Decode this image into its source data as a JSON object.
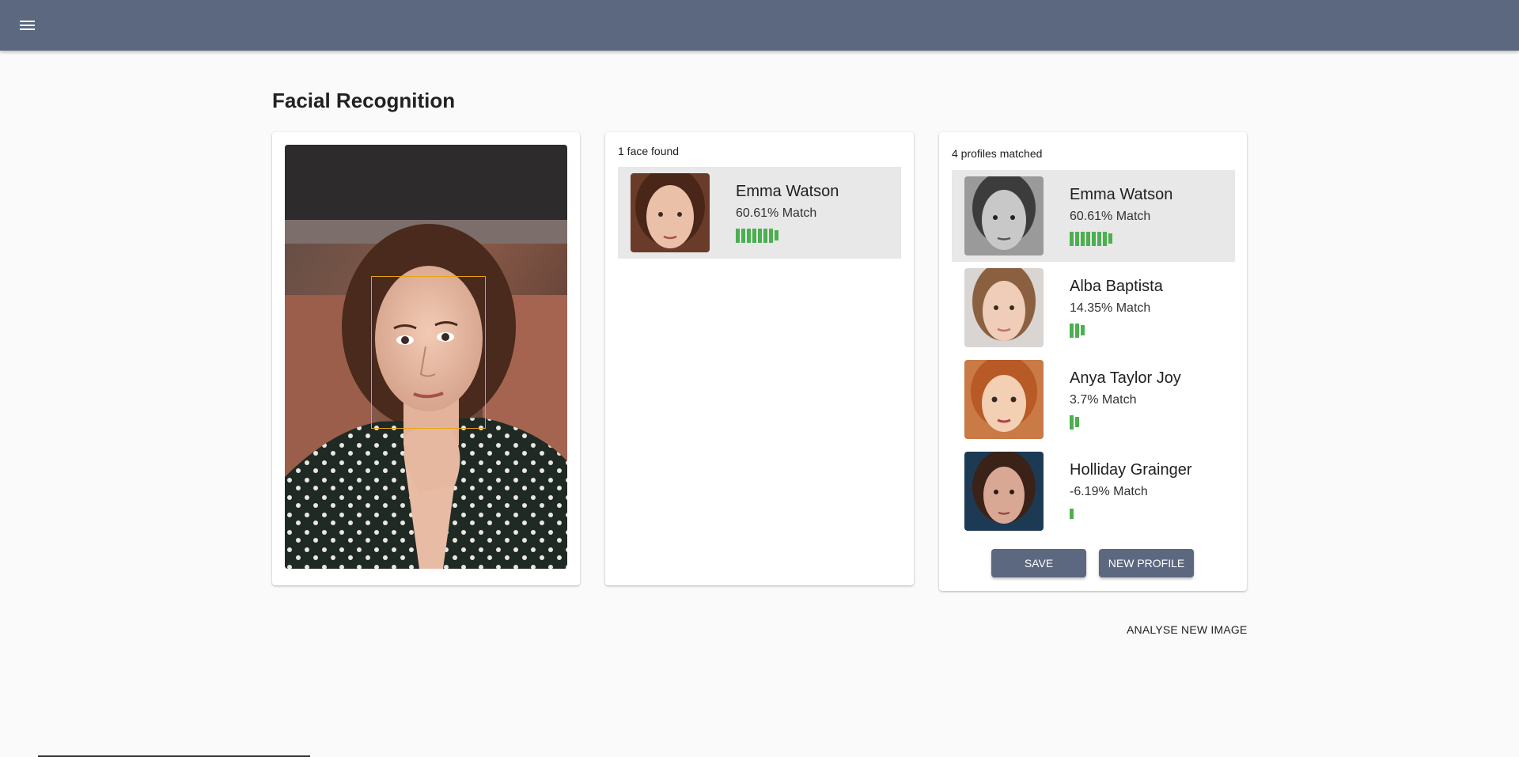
{
  "header": {
    "menu_icon": "hamburger-menu-icon",
    "bg_color": "#5c6780"
  },
  "page": {
    "title": "Facial Recognition"
  },
  "faces": {
    "count_label": "1 face found",
    "items": [
      {
        "name": "Emma Watson",
        "match": "60.61% Match",
        "match_pct": 60.61,
        "bar_count": 7
      }
    ]
  },
  "profiles": {
    "count_label": "4 profiles matched",
    "items": [
      {
        "name": "Emma Watson",
        "match": "60.61% Match",
        "match_pct": 60.61,
        "bar_count": 7
      },
      {
        "name": "Alba Baptista",
        "match": "14.35% Match",
        "match_pct": 14.35,
        "bar_count": 3
      },
      {
        "name": "Anya Taylor Joy",
        "match": "3.7% Match",
        "match_pct": 3.7,
        "bar_count": 2
      },
      {
        "name": "Holliday Grainger",
        "match": "-6.19% Match",
        "match_pct": -6.19,
        "bar_count": 1
      }
    ],
    "save_label": "SAVE",
    "new_profile_label": "NEW PROFILE"
  },
  "actions": {
    "analyse_label": "ANALYSE NEW IMAGE"
  },
  "colors": {
    "accent": "#5c6780",
    "match_bar": "#4caf50",
    "face_box": "#e8a317",
    "selected_row": "#e8e8e8"
  }
}
